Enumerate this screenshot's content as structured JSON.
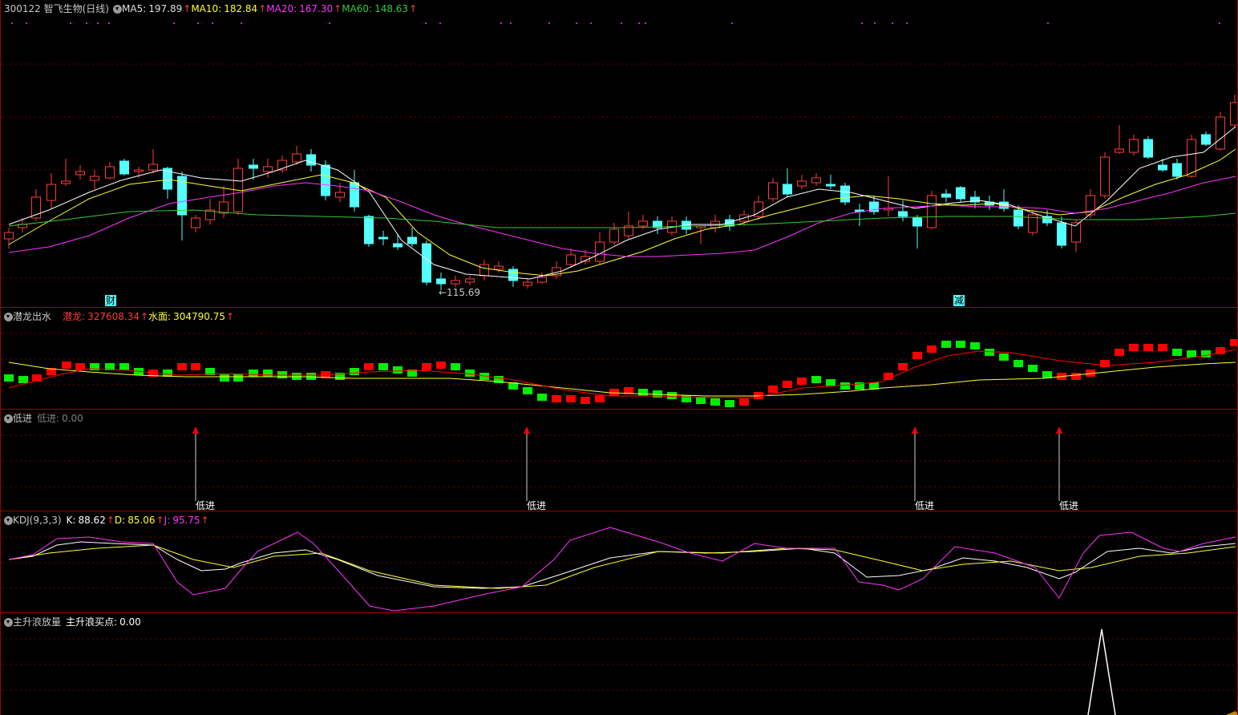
{
  "stock": {
    "code_name": "300122 智飞生物(日线)"
  },
  "colors": {
    "bg": "#000000",
    "border": "#a00000",
    "grid": "#700000",
    "up": "#ff3b3b",
    "down": "#54ffff",
    "ma5": "#ffffff",
    "ma10": "#ffff33",
    "ma20": "#ff33ff",
    "ma60": "#33cc33",
    "kdj_k": "#ffffff",
    "kdj_d": "#ffff33",
    "kdj_j": "#ff33ff",
    "lq_red": "#ff0000",
    "lq_green": "#00ee00"
  },
  "main": {
    "ma": [
      {
        "label": "MA5:",
        "value": "197.89",
        "arrow": "↑",
        "color": "#e0e0e0"
      },
      {
        "label": "MA10:",
        "value": "182.84",
        "arrow": "↑",
        "color": "#ffff33"
      },
      {
        "label": "MA20:",
        "value": "167.30",
        "arrow": "↑",
        "color": "#ff33ff"
      },
      {
        "label": "MA60:",
        "value": "148.63",
        "arrow": "↑",
        "color": "#33cc33"
      }
    ],
    "low_marker": "←115.69",
    "cai_label": "财",
    "jian_label": "减"
  },
  "qianlong": {
    "title": "潜龙出水",
    "qianlong_label": "潜龙:",
    "qianlong_value": "327608.34",
    "qianlong_arrow": "↑",
    "shuimian_label": "水面:",
    "shuimian_value": "304790.75",
    "shuimian_arrow": "↑"
  },
  "dijin": {
    "title": "低进",
    "value_label": "低进:",
    "value": "0.00",
    "signal_label": "低进",
    "signals": [
      243,
      656,
      1140,
      1320
    ]
  },
  "kdj": {
    "title": "KDJ(9,3,3)",
    "k_label": "K:",
    "k_value": "88.62",
    "k_arrow": "↑",
    "d_label": "D:",
    "d_value": "85.06",
    "d_arrow": "↑",
    "j_label": "J:",
    "j_value": "95.75",
    "j_arrow": "↑"
  },
  "zhushenglang": {
    "title": "主升浪放量",
    "value_label": "主升浪买点:",
    "value": "0.00"
  }
}
